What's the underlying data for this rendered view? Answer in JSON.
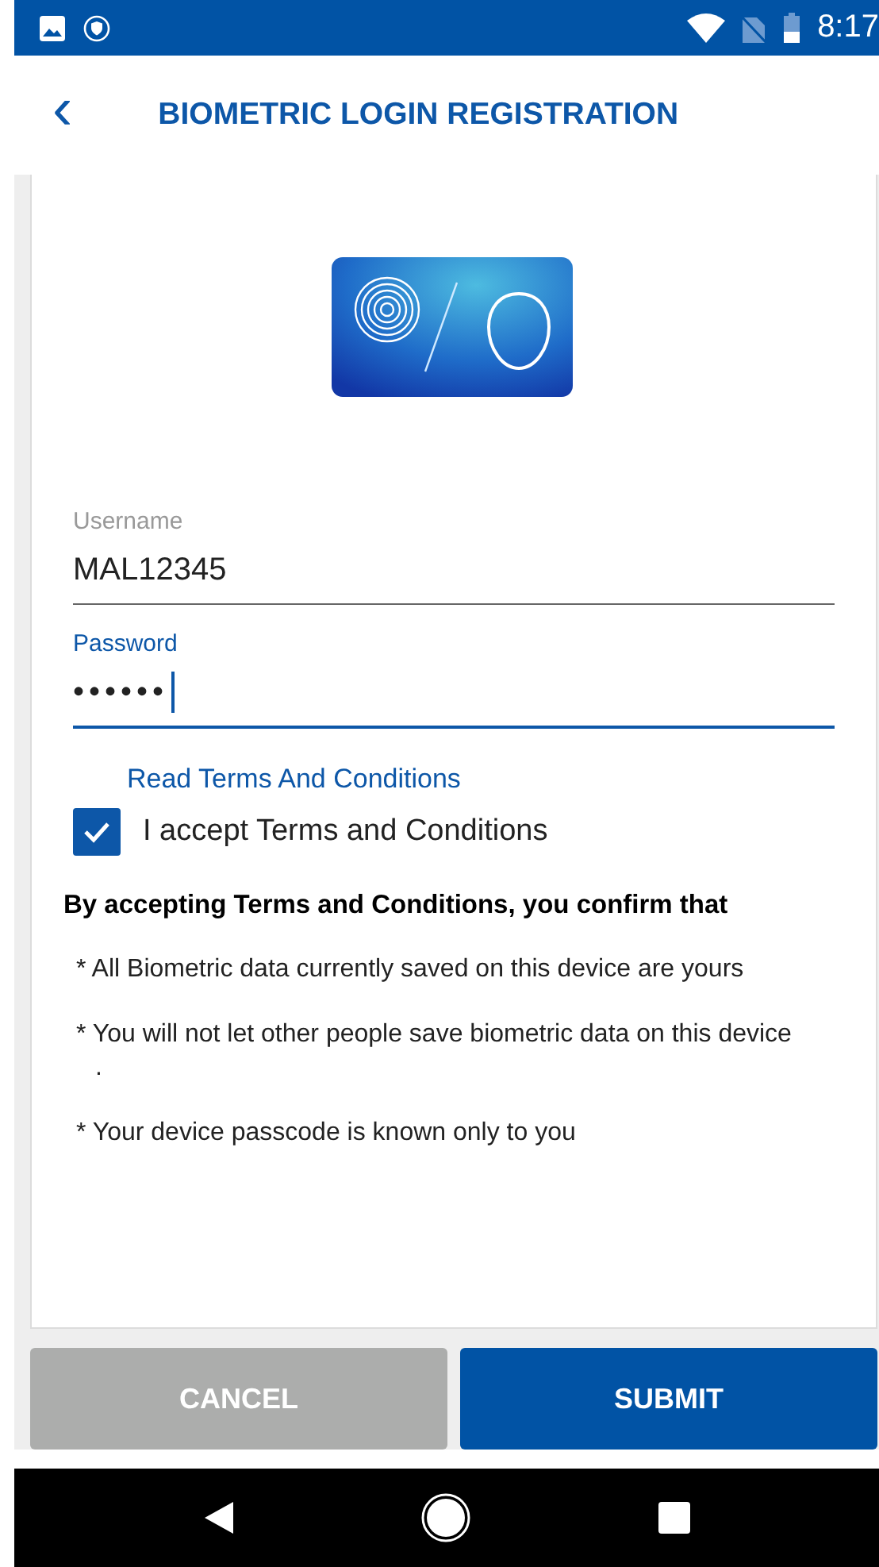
{
  "status_bar": {
    "time": "8:17"
  },
  "header": {
    "back": "‹",
    "title": "BIOMETRIC LOGIN REGISTRATION"
  },
  "form": {
    "fields": [
      {
        "label": "Username",
        "value": "MAL12345",
        "focused": false
      },
      {
        "label": "Password",
        "value": "••••••",
        "focused": true
      }
    ],
    "terms_link": "Read Terms And Conditions",
    "accept": {
      "label": "I accept Terms and Conditions",
      "checked": true
    },
    "notice": "By accepting Terms and Conditions, you confirm that",
    "bullets": [
      "* All Biometric data currently saved on this device are yours",
      "* You will not let other people save biometric data on this device .",
      "* Your device passcode is known only to you"
    ]
  },
  "buttons": [
    {
      "label": "CANCEL",
      "kind": "secondary"
    },
    {
      "label": "SUBMIT",
      "kind": "primary"
    }
  ]
}
